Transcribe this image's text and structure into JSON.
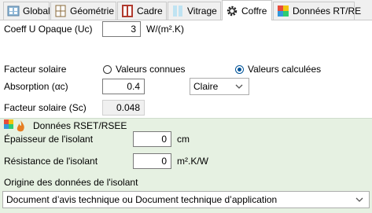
{
  "tabs": [
    {
      "label": "Global",
      "icon": "global-icon"
    },
    {
      "label": "Géométrie",
      "icon": "geometry-icon"
    },
    {
      "label": "Cadre",
      "icon": "frame-icon"
    },
    {
      "label": "Vitrage",
      "icon": "glazing-icon"
    },
    {
      "label": "Coffre",
      "icon": "gear-icon",
      "active": true
    },
    {
      "label": "Données RT/RE",
      "icon": "rt-re-icon"
    }
  ],
  "fields": {
    "u_opaque": {
      "label": "Coeff U Opaque (Uc)",
      "value": "3",
      "unit": "W/(m².K)"
    },
    "facteur_solaire": {
      "label": "Facteur solaire",
      "option_known": "Valeurs connues",
      "option_computed": "Valeurs calculées",
      "selected": "Valeurs calculées"
    },
    "absorption": {
      "label": "Absorption (αc)",
      "value": "0.4",
      "color_option": "Claire"
    },
    "facteur_sc": {
      "label": "Facteur solaire (Sc)",
      "value": "0.048"
    }
  },
  "rset": {
    "section_title": "Données RSET/RSEE",
    "epaisseur": {
      "label": "Épaisseur de l'isolant",
      "value": "0",
      "unit": "cm"
    },
    "resistance": {
      "label": "Résistance de l'isolant",
      "value": "0",
      "unit": "m².K/W"
    },
    "origine": {
      "label": "Origine des données de l'isolant",
      "value": "Document d’avis technique ou Document technique d’application"
    }
  },
  "colors": {
    "section_bg": "#e6f1e2",
    "radio_accent": "#005499"
  }
}
